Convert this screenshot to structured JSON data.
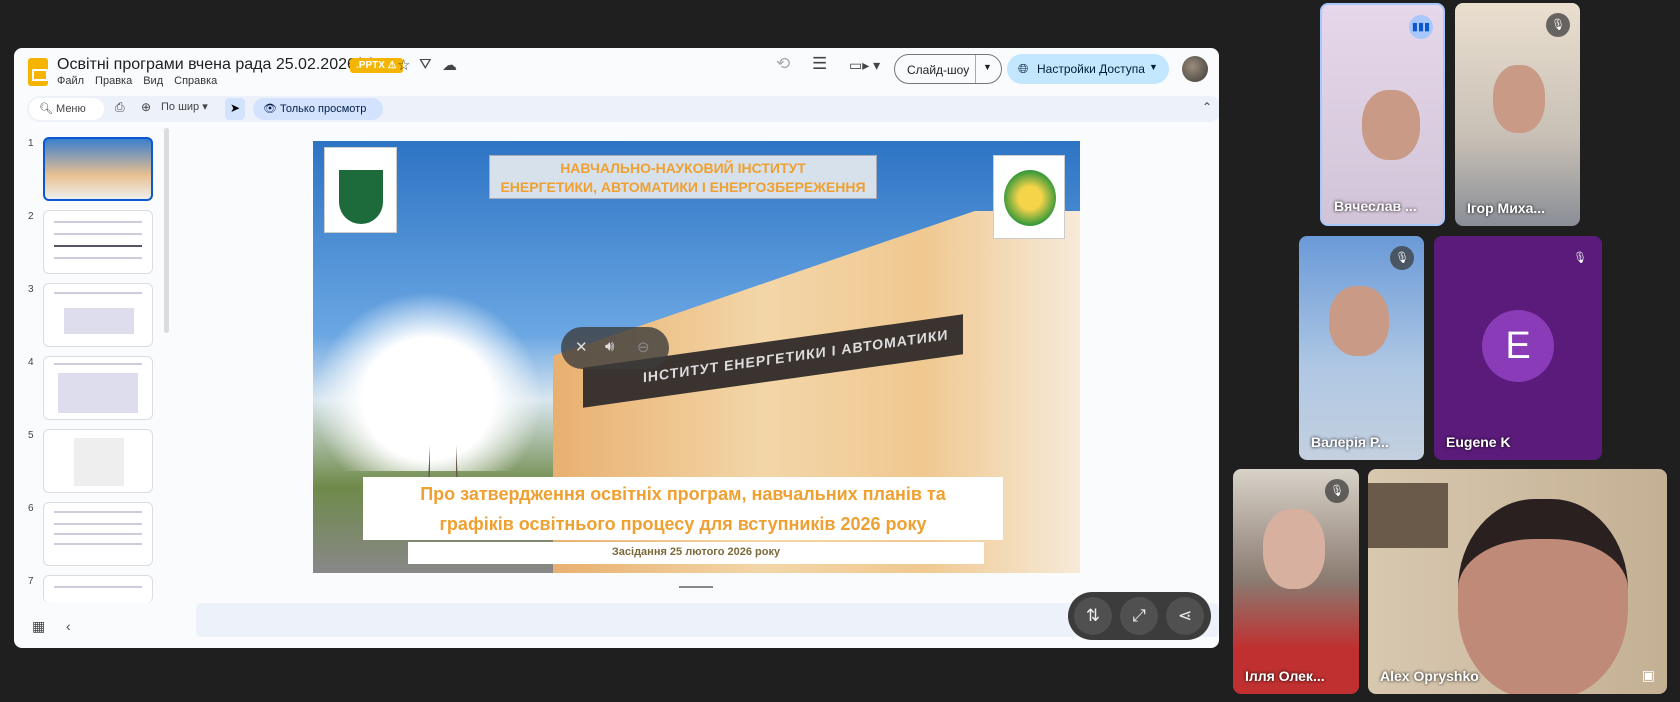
{
  "header": {
    "title": "Освітні програми вчена рада 25.02.2026(1)",
    "badge": ".PPTX ⚠",
    "menu": [
      "Файл",
      "Правка",
      "Вид",
      "Справка"
    ],
    "slideshow": "Слайд-шоу",
    "share": "Настройки Доступа"
  },
  "toolbar": {
    "search": "Меню",
    "zoom": "По шир",
    "view_mode": "Только просмотр"
  },
  "thumbnails": [
    "1",
    "2",
    "3",
    "4",
    "5",
    "6",
    "7"
  ],
  "slide": {
    "header_line1": "НАВЧАЛЬНО-НАУКОВИЙ ІНСТИТУТ",
    "header_line2": "ЕНЕРГЕТИКИ, АВТОМАТИКИ І ЕНЕРГОЗБЕРЕЖЕННЯ",
    "building_sign": "ІНСТИТУТ ЕНЕРГЕТИКИ І АВТОМАТИКИ",
    "title_line1": "Про затвердження освітніх програм, навчальних планів та",
    "title_line2": "графіків освітнього процесу для вступників 2026 року",
    "date": "Засідання 25 лютого 2026 року"
  },
  "participants": [
    {
      "name": "Вячеслав ...",
      "initial": ""
    },
    {
      "name": "Ігор Миха...",
      "initial": ""
    },
    {
      "name": "Валерія Р...",
      "initial": ""
    },
    {
      "name": "Eugene K",
      "initial": "E"
    },
    {
      "name": "Ілля Олек...",
      "initial": ""
    },
    {
      "name": "Alex Opryshko",
      "initial": ""
    }
  ],
  "colors": {
    "accent": "#0b57d0",
    "share_bg": "#c2e7ff",
    "slide_orange": "#f0a030",
    "eugene_bg": "#5b1b7a"
  }
}
